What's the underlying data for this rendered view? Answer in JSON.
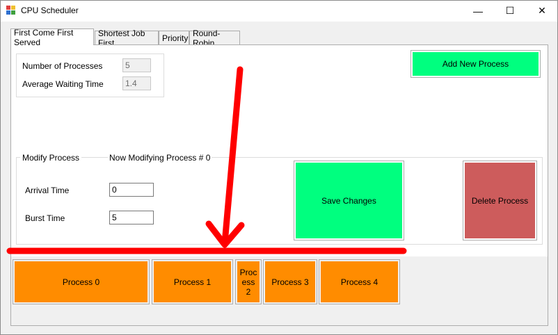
{
  "window": {
    "title": "CPU Scheduler",
    "controls": {
      "minimize": "—",
      "maximize": "☐",
      "close": "✕"
    }
  },
  "tabs": [
    {
      "label": "First Come First Served",
      "active": true
    },
    {
      "label": "Shortest Job First",
      "active": false
    },
    {
      "label": "Priority",
      "active": false
    },
    {
      "label": "Round-Robin",
      "active": false
    }
  ],
  "stats": {
    "num_processes_label": "Number of Processes",
    "num_processes_value": "5",
    "avg_wait_label": "Average Waiting Time",
    "avg_wait_value": "1.4"
  },
  "buttons": {
    "add_new": "Add New Process",
    "save": "Save Changes",
    "delete": "Delete Process"
  },
  "modify": {
    "group_label": "Modify Process",
    "status": "Now Modifying Process # 0",
    "arrival_label": "Arrival Time",
    "arrival_value": "0",
    "burst_label": "Burst Time",
    "burst_value": "5"
  },
  "gantt": [
    {
      "label": "Process 0"
    },
    {
      "label": "Process 1"
    },
    {
      "label": "Proc ess 2"
    },
    {
      "label": "Process 3"
    },
    {
      "label": "Process 4"
    }
  ],
  "colors": {
    "process_block": "#ff8c00",
    "green_button": "#00ff7f",
    "red_button": "#cd5c5c",
    "annotation": "#ff0000"
  }
}
